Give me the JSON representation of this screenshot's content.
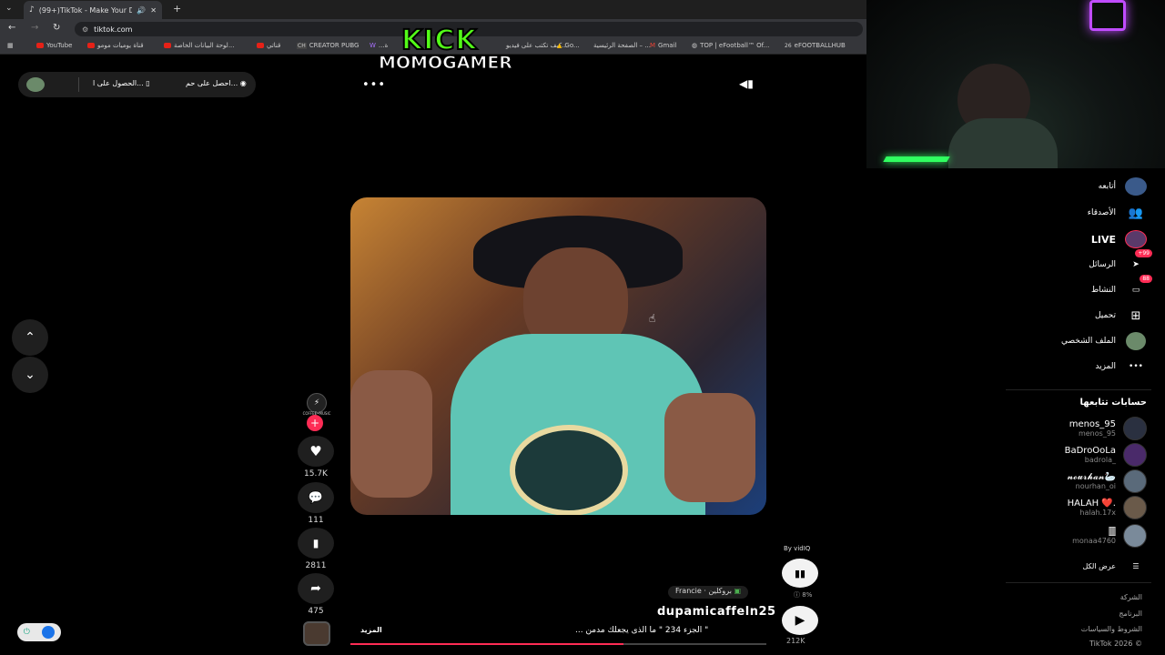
{
  "browser": {
    "tab_title": "(99+)TikTok - Make Your Da",
    "url": "tiktok.com",
    "new_tab": "+",
    "bookmarks": [
      "YouTube",
      "قناة يوميات مومو",
      "لوحة البيانات الخاصة...",
      "قناتي",
      "CREATOR PUBG",
      "...ة",
      "كيف تكتب على فيديو...",
      "Go...",
      "الصفحة الرئيسية – ...",
      "Gmail",
      "TOP | eFootball™ Of...",
      "eFOOTBALLHUB"
    ]
  },
  "overlay": {
    "kick": "KICK",
    "streamer": "MOMOGAMER"
  },
  "top_pill": {
    "item1": "احصل على حم...",
    "item2": "الحصول على ا..."
  },
  "video": {
    "likes": "15.7K",
    "comments": "111",
    "saves": "2811",
    "shares": "475",
    "location": "Francie · بروكلين",
    "username": "dupamicaffeln25",
    "caption": "\" الجزء 234 \" ما الذى يجعلك مدمن ...",
    "more": "المزيد",
    "by": "By vidIQ",
    "stat_percent": "8%",
    "views": "212K",
    "avatar_caption": "COFFEE•MUSIC"
  },
  "sidebar": {
    "items": [
      {
        "label": "أتابعه"
      },
      {
        "label": "الأصدقاء"
      },
      {
        "label": "LIVE"
      },
      {
        "label": "الرسائل",
        "badge": "+99"
      },
      {
        "label": "النشاط",
        "badge": "88"
      },
      {
        "label": "تحميل"
      },
      {
        "label": "الملف الشخصي"
      },
      {
        "label": "المزيد"
      }
    ],
    "following_title": "حسابات تتابعها",
    "accounts": [
      {
        "name": "menos_95",
        "handle": "menos_95"
      },
      {
        "name": "BaDroOoLa",
        "handle": "badrola_"
      },
      {
        "name": "𝓷𝓸𝓾𝓻𝓱𝓪𝓷🦢",
        "handle": "nourhan_oi"
      },
      {
        "name": "HALAH ❤️.",
        "handle": "halah.17x"
      },
      {
        "name": "🀫",
        "handle": "monaa4760"
      }
    ],
    "see_all": "عرض الكل",
    "footer": [
      "الشركة",
      "البرنامج",
      "الشروط والسياسات",
      "TikTok 2026 ©"
    ]
  }
}
